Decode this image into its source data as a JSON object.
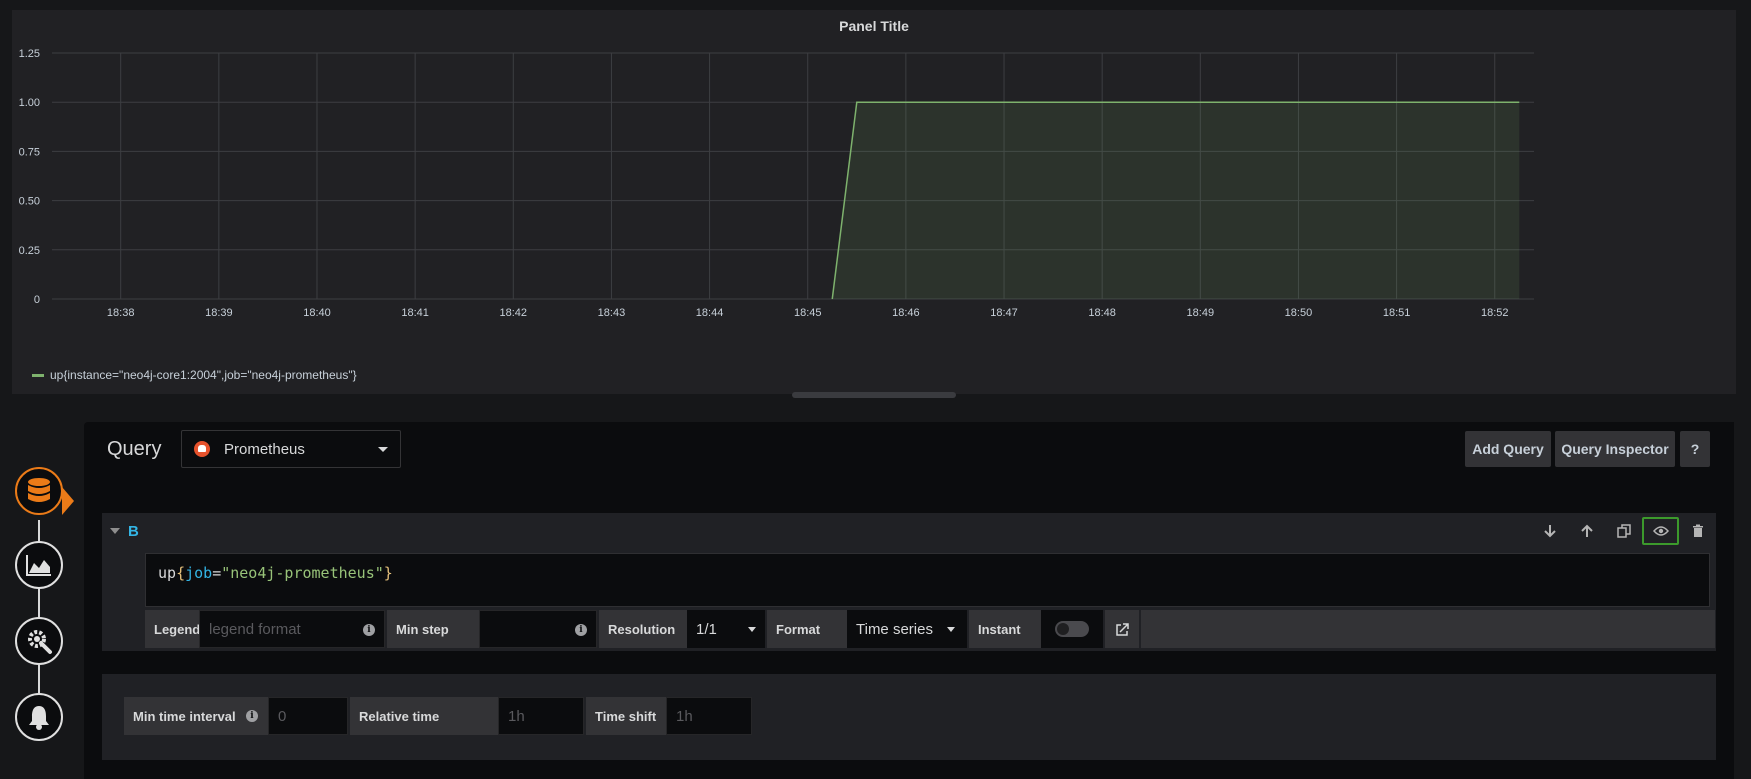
{
  "panel": {
    "title": "Panel Title",
    "legend_label": "up{instance=\"neo4j-core1:2004\",job=\"neo4j-prometheus\"}"
  },
  "chart_data": {
    "type": "area",
    "title": "Panel Title",
    "x_ticks": [
      "18:38",
      "18:39",
      "18:40",
      "18:41",
      "18:42",
      "18:43",
      "18:44",
      "18:45",
      "18:46",
      "18:47",
      "18:48",
      "18:49",
      "18:50",
      "18:51",
      "18:52"
    ],
    "y_ticks": [
      "0",
      "0.25",
      "0.50",
      "0.75",
      "1.00",
      "1.25"
    ],
    "ylim": [
      0,
      1.25
    ],
    "xlim_minutes": [
      37.3,
      52.4
    ],
    "grid": true,
    "legend_position": "bottom-left",
    "series": [
      {
        "name": "up{instance=\"neo4j-core1:2004\",job=\"neo4j-prometheus\"}",
        "color": "#7eb26d",
        "points": [
          {
            "x": "18:45:15",
            "y": 0
          },
          {
            "x": "18:45:30",
            "y": 1
          },
          {
            "x": "18:52:15",
            "y": 1
          }
        ]
      }
    ]
  },
  "editor": {
    "query_label": "Query",
    "datasource": "Prometheus",
    "add_query": "Add Query",
    "query_inspector": "Query Inspector",
    "help": "?"
  },
  "query_row": {
    "letter": "B",
    "expr_metric": "up",
    "expr_key": "job",
    "expr_value": "\"neo4j-prometheus\"",
    "legend_label": "Legend",
    "legend_placeholder": "legend format",
    "min_step_label": "Min step",
    "resolution_label": "Resolution",
    "resolution_value": "1/1",
    "format_label": "Format",
    "format_value": "Time series",
    "instant_label": "Instant"
  },
  "options": {
    "min_interval_label": "Min time interval",
    "min_interval_placeholder": "0",
    "relative_time_label": "Relative time",
    "relative_time_placeholder": "1h",
    "time_shift_label": "Time shift",
    "time_shift_placeholder": "1h"
  },
  "icons": {
    "nav": [
      "database-icon",
      "chart-icon",
      "settings-icon",
      "bell-icon"
    ],
    "row_actions": [
      "arrow-down-icon",
      "arrow-up-icon",
      "duplicate-icon",
      "eye-icon",
      "trash-icon"
    ]
  },
  "colors": {
    "accent": "#eb7b18",
    "series": "#7eb26d",
    "query_letter": "#33b5e5",
    "highlight": "#3c9a2c"
  }
}
